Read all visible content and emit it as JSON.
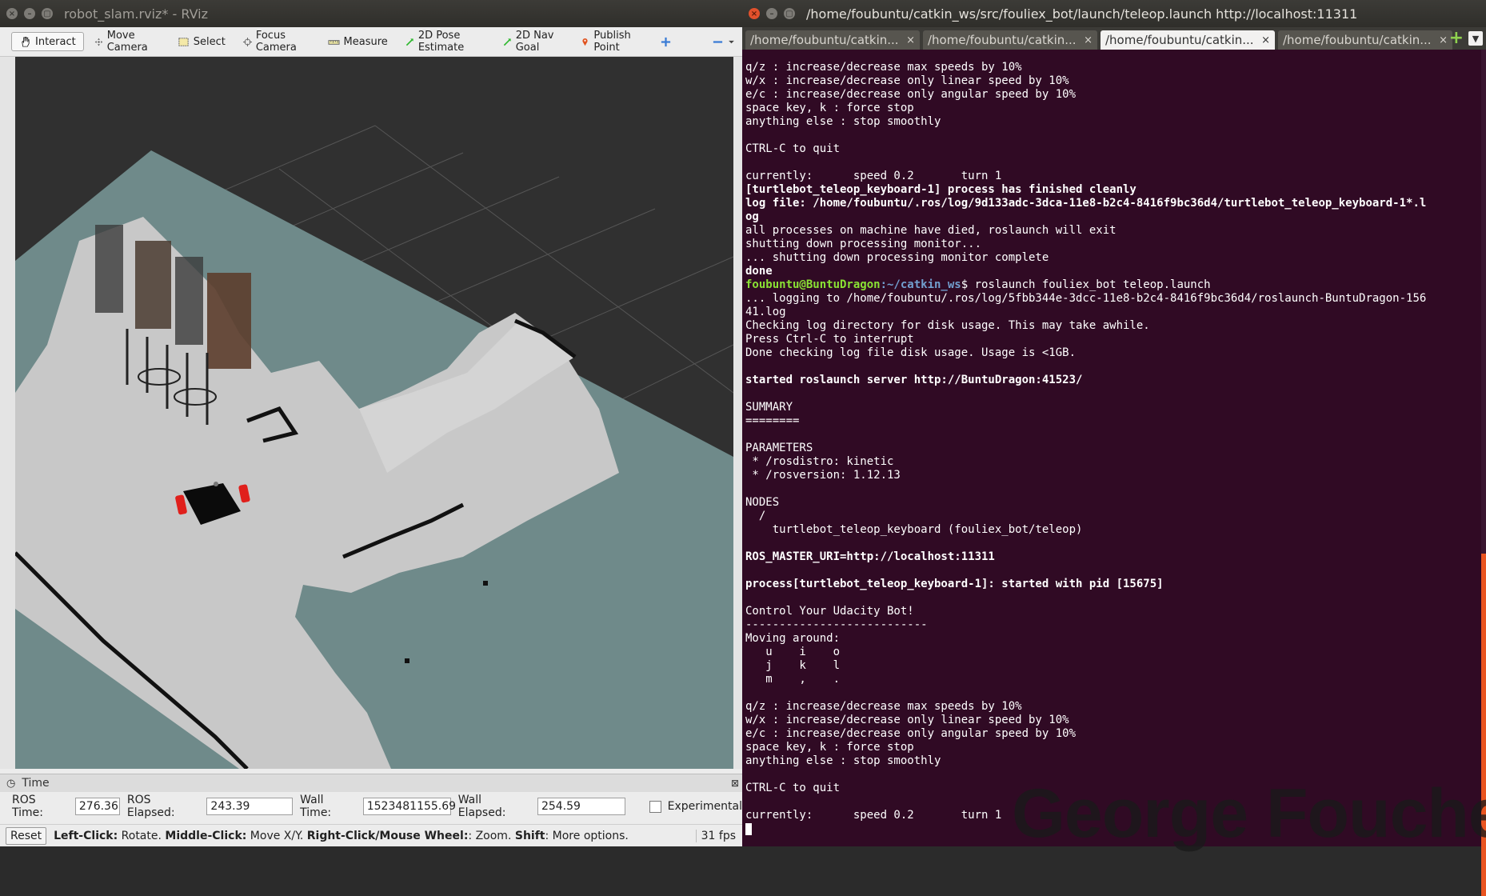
{
  "rviz": {
    "title": "robot_slam.rviz* - RViz",
    "tools": [
      {
        "label": "Interact",
        "icon": "hand-icon"
      },
      {
        "label": "Move Camera",
        "icon": "move-camera-icon"
      },
      {
        "label": "Select",
        "icon": "select-icon"
      },
      {
        "label": "Focus Camera",
        "icon": "focus-camera-icon"
      },
      {
        "label": "Measure",
        "icon": "ruler-icon"
      },
      {
        "label": "2D Pose Estimate",
        "icon": "green-arrow-icon"
      },
      {
        "label": "2D Nav Goal",
        "icon": "green-arrow-icon"
      },
      {
        "label": "Publish Point",
        "icon": "map-pin-icon"
      }
    ],
    "time_panel": {
      "title": "Time",
      "ros_time_label": "ROS Time:",
      "ros_time": "276.36",
      "ros_elapsed_label": "ROS Elapsed:",
      "ros_elapsed": "243.39",
      "wall_time_label": "Wall Time:",
      "wall_time": "1523481155.69",
      "wall_elapsed_label": "Wall Elapsed:",
      "wall_elapsed": "254.59",
      "experimental_label": "Experimental"
    },
    "status": {
      "reset_label": "Reset",
      "k1": "Left-Click:",
      "v1": " Rotate. ",
      "k2": "Middle-Click:",
      "v2": " Move X/Y. ",
      "k3": "Right-Click/Mouse Wheel:",
      "v3": ": Zoom. ",
      "k4": "Shift",
      "v4": ": More options.",
      "fps": "31 fps"
    }
  },
  "terminal": {
    "title": "/home/foubuntu/catkin_ws/src/fouliex_bot/launch/teleop.launch http://localhost:11311",
    "tabs": [
      "/home/foubuntu/catkin...",
      "/home/foubuntu/catkin...",
      "/home/foubuntu/catkin...",
      "/home/foubuntu/catkin..."
    ],
    "active_tab": 2,
    "prompt_user": "foubuntu@BuntuDragon",
    "prompt_path": ":~/catkin_ws",
    "prompt_cmd": "$ roslaunch fouliex_bot teleop.launch",
    "lines": [
      {
        "t": "q/z : increase/decrease max speeds by 10%"
      },
      {
        "t": "w/x : increase/decrease only linear speed by 10%"
      },
      {
        "t": "e/c : increase/decrease only angular speed by 10%"
      },
      {
        "t": "space key, k : force stop"
      },
      {
        "t": "anything else : stop smoothly"
      },
      {
        "t": ""
      },
      {
        "t": "CTRL-C to quit"
      },
      {
        "t": ""
      },
      {
        "t": "currently:      speed 0.2       turn 1"
      },
      {
        "t": "[turtlebot_teleop_keyboard-1] process has finished cleanly",
        "b": true
      },
      {
        "t": "log file: /home/foubuntu/.ros/log/9d133adc-3dca-11e8-b2c4-8416f9bc36d4/turtlebot_teleop_keyboard-1*.l",
        "b": true
      },
      {
        "t": "og",
        "b": true
      },
      {
        "t": "all processes on machine have died, roslaunch will exit"
      },
      {
        "t": "shutting down processing monitor..."
      },
      {
        "t": "... shutting down processing monitor complete"
      },
      {
        "t": "done",
        "b": true
      },
      {
        "prompt": true
      },
      {
        "t": "... logging to /home/foubuntu/.ros/log/5fbb344e-3dcc-11e8-b2c4-8416f9bc36d4/roslaunch-BuntuDragon-156"
      },
      {
        "t": "41.log"
      },
      {
        "t": "Checking log directory for disk usage. This may take awhile."
      },
      {
        "t": "Press Ctrl-C to interrupt"
      },
      {
        "t": "Done checking log file disk usage. Usage is <1GB."
      },
      {
        "t": ""
      },
      {
        "t": "started roslaunch server http://BuntuDragon:41523/",
        "b": true
      },
      {
        "t": ""
      },
      {
        "t": "SUMMARY"
      },
      {
        "t": "========"
      },
      {
        "t": ""
      },
      {
        "t": "PARAMETERS"
      },
      {
        "t": " * /rosdistro: kinetic"
      },
      {
        "t": " * /rosversion: 1.12.13"
      },
      {
        "t": ""
      },
      {
        "t": "NODES"
      },
      {
        "t": "  /"
      },
      {
        "t": "    turtlebot_teleop_keyboard (fouliex_bot/teleop)"
      },
      {
        "t": ""
      },
      {
        "t": "ROS_MASTER_URI=http://localhost:11311",
        "b": true
      },
      {
        "t": ""
      },
      {
        "t": "process[turtlebot_teleop_keyboard-1]: started with pid [15675]",
        "b": true
      },
      {
        "t": ""
      },
      {
        "t": "Control Your Udacity Bot!"
      },
      {
        "t": "---------------------------"
      },
      {
        "t": "Moving around:"
      },
      {
        "t": "   u    i    o"
      },
      {
        "t": "   j    k    l"
      },
      {
        "t": "   m    ,    ."
      },
      {
        "t": ""
      },
      {
        "t": "q/z : increase/decrease max speeds by 10%"
      },
      {
        "t": "w/x : increase/decrease only linear speed by 10%"
      },
      {
        "t": "e/c : increase/decrease only angular speed by 10%"
      },
      {
        "t": "space key, k : force stop"
      },
      {
        "t": "anything else : stop smoothly"
      },
      {
        "t": ""
      },
      {
        "t": "CTRL-C to quit"
      },
      {
        "t": ""
      },
      {
        "t": "currently:      speed 0.2       turn 1"
      }
    ],
    "watermark": "George Fouche"
  },
  "colors": {
    "terminal_bg": "#300a24",
    "prompt_user": "#8ae234",
    "prompt_path": "#729fcf",
    "map_free": "#c8c8c8",
    "map_unknown": "#6f8a8a",
    "robot_wheels": "#e0201c"
  }
}
